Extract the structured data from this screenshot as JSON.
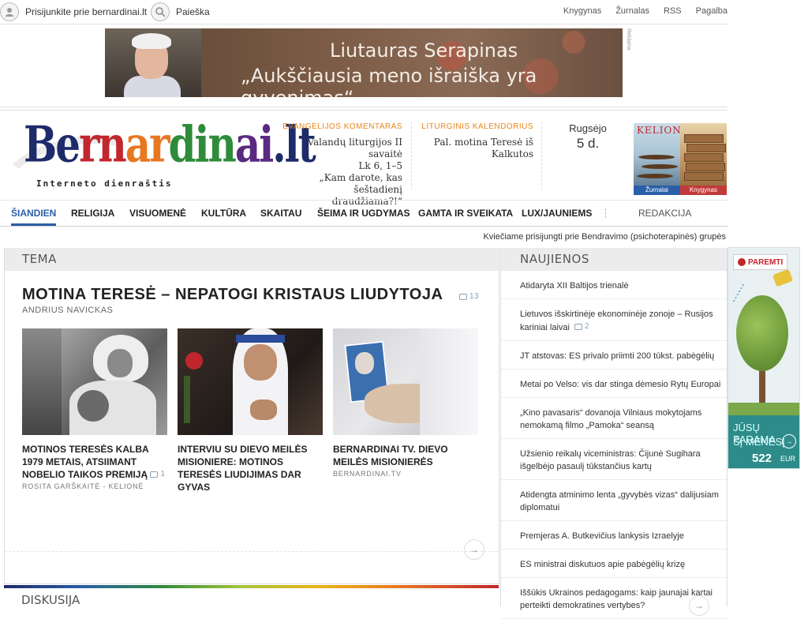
{
  "topbar": {
    "login_label": "Prisijunkite prie bernardinai.lt",
    "search_label": "Paieška",
    "links": [
      "Knygynas",
      "Žurnalas",
      "RSS",
      "Pagalba"
    ]
  },
  "ad_banner": {
    "name": "Liutauras Serapinas",
    "quote": "„Aukščiausia meno išraiška yra gyvenimas“",
    "tag": "Reklama"
  },
  "logo": {
    "parts": [
      "Be",
      "rn",
      "ar",
      "din",
      "ai",
      ".lt"
    ],
    "subtitle": "Interneto dienraštis"
  },
  "evangelijos": {
    "heading": "EVANGELIJOS KOMENTARAS",
    "lines": [
      "Valandų liturgijos II savaitė",
      "Lk 6, 1–5",
      "„Kam darote, kas šeštadienį draudžiama?!“"
    ]
  },
  "liturginis": {
    "heading": "LITURGINIS KALENDORIUS",
    "lines": [
      "Pal. motina Teresė iš Kalkutos"
    ]
  },
  "date": {
    "month": "Rugsėjo",
    "day": "5 d."
  },
  "magazines": [
    {
      "title": "KELIONĖ",
      "label": "Žurnalai"
    },
    {
      "title": "",
      "label": "Knygynas"
    }
  ],
  "nav": {
    "items": [
      "ŠIANDIEN",
      "RELIGIJA",
      "VISUOMENĖ",
      "KULTŪRA",
      "SKAITAU",
      "ŠEIMA IR UGDYMAS",
      "GAMTA IR SVEIKATA",
      "LUX/JAUNIEMS"
    ],
    "active": "ŠIANDIEN",
    "redakcija": "REDAKCIJA"
  },
  "ticker": "Kviečiame prisijungti prie Bendravimo (psichoterapinės) grupės",
  "tema": {
    "section_title": "TEMA",
    "main_title": "MOTINA TERESĖ – NEPATOGI KRISTAUS LIUDYTOJA",
    "main_comments": "13",
    "main_author": "ANDRIUS NAVICKAS",
    "cards": [
      {
        "title": "MOTINOS TERESĖS KALBA 1979 METAIS, ATSIIMANT NOBELIO TAIKOS PREMIJĄ",
        "comments": "1",
        "author": "ROSITA GARŠKAITĖ - KELIONĖ"
      },
      {
        "title": "INTERVIU SU DIEVO MEILĖS MISIONIERE: MOTINOS TERESĖS LIUDIJIMAS DAR GYVAS",
        "comments": "",
        "author": ""
      },
      {
        "title": "BERNARDINAI TV. DIEVO MEILĖS MISIONIERĖS",
        "comments": "",
        "author": "BERNARDINAI.TV"
      }
    ],
    "arrow": "→"
  },
  "diskusija": {
    "section_title": "DISKUSIJA"
  },
  "news": {
    "section_title": "NAUJIENOS",
    "items": [
      {
        "text": "Atidaryta XII Baltijos trienalė",
        "comments": ""
      },
      {
        "text": "Lietuvos išskirtinėje ekonominėje zonoje – Rusijos kariniai laivai",
        "comments": "2"
      },
      {
        "text": "JT atstovas: ES privalo priimti 200 tūkst. pabėgėlių",
        "comments": ""
      },
      {
        "text": "Metai po Velso: vis dar stinga dėmesio Rytų Europai",
        "comments": ""
      },
      {
        "text": "„Kino pavasaris“ dovanoja Vilniaus mokytojams nemokamą filmo „Pamoka“ seansą",
        "comments": ""
      },
      {
        "text": "Užsienio reikalų viceministras: Čijunė Sugihara išgelbėjo pasaulį tūkstančius kartų",
        "comments": ""
      },
      {
        "text": "Atidengta atminimo lenta „gyvybės vizas“ dalijusiam diplomatui",
        "comments": ""
      },
      {
        "text": "Premjeras A. Butkevičius lankysis Izraelyje",
        "comments": ""
      },
      {
        "text": "ES ministrai diskutuos apie pabėgėlių krizę",
        "comments": ""
      },
      {
        "text": "Iššūkis Ukrainos pedagogams: kaip jaunajai kartai perteikti demokratines vertybes?",
        "comments": ""
      }
    ],
    "arrow": "→"
  },
  "paremti": {
    "badge": "PAREMTI",
    "line1": "JŪSŲ PARAMA",
    "line2": "ŠĮ MĖNESĮ",
    "amount": "522",
    "currency": "EUR",
    "arrow": "→"
  }
}
